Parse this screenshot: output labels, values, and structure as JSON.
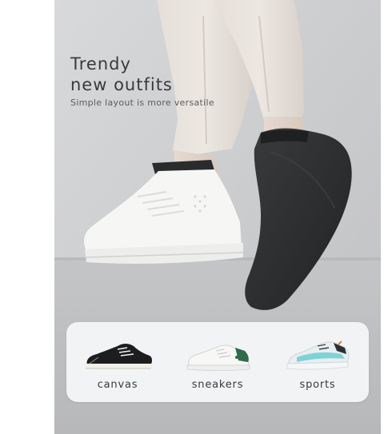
{
  "hero": {
    "title_line1": "Trendy",
    "title_line2": "new outfits",
    "tagline": "Simple layout is more versatile"
  },
  "shoe_types": [
    {
      "label": "canvas",
      "icon": "canvas-shoe-icon"
    },
    {
      "label": "sneakers",
      "icon": "white-sneaker-icon"
    },
    {
      "label": "sports",
      "icon": "running-shoe-icon"
    }
  ],
  "colors": {
    "background": "#cfd0d2",
    "panel": "#f2f3f4",
    "text": "#3a3a3a",
    "sock": "#2d2e30"
  }
}
